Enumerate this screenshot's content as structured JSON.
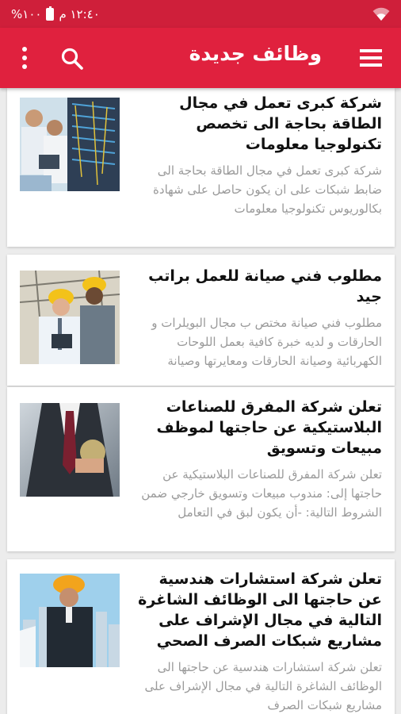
{
  "status_bar": {
    "time": "١٢:٤٠ م",
    "battery": "١٠٠%",
    "wifi_icon": "wifi-icon",
    "battery_icon": "battery-icon"
  },
  "app_bar": {
    "title": "وظائف جديدة",
    "menu_icon": "hamburger-menu-icon",
    "search_icon": "search-icon",
    "overflow_icon": "more-vertical-icon",
    "color": "#e0213e"
  },
  "jobs": [
    {
      "headline": "شركة كبرى تعمل في مجال الطاقة بحاجة الى تخصص تكنولوجيا معلومات",
      "excerpt": "شركة كبرى تعمل في مجال الطاقة بحاجة الى ضابط شبكات على ان يكون حاصل على شهادة بكالوريوس تكنولوجيا معلومات",
      "image": "technicians-server-room-photo"
    },
    {
      "headline": "مطلوب فني صيانة للعمل براتب جيد",
      "excerpt": "مطلوب فني صيانة مختص ب مجال البويلرات و الحارقات و لديه خبرة كافية بعمل اللوحات الكهربائية وصيانة الحارقات ومعايرتها وصيانة",
      "image": "engineers-hard-hats-photo"
    },
    {
      "headline": "تعلن شركة المفرق للصناعات البلاستيكية عن حاجتها لموظف مبيعات وتسويق",
      "excerpt": "تعلن شركة المفرق للصناعات البلاستيكية عن حاجتها إلى: مندوب مبيعات وتسويق خارجي ضمن الشروط التالية: -أن يكون لبق في التعامل",
      "image": "businessman-tie-photo"
    },
    {
      "headline": "تعلن شركة استشارات هندسية عن حاجتها الى الوظائف الشاغرة التالية في مجال الإشراف على مشاريع شبكات الصرف الصحي",
      "excerpt": "تعلن شركة استشارات هندسية عن حاجتها الى الوظائف الشاغرة التالية في مجال الإشراف على مشاريع شبكات الصرف",
      "image": "engineer-city-blueprint-photo"
    }
  ]
}
